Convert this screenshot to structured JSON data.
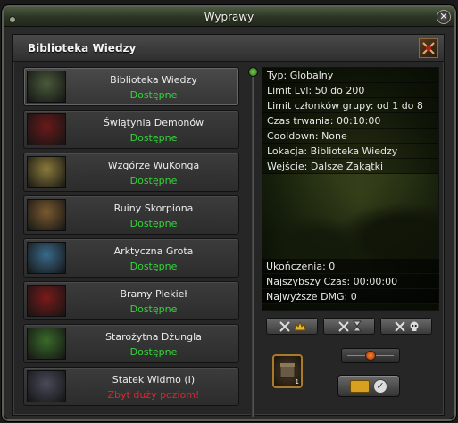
{
  "window": {
    "title": "Wyprawy",
    "close_icon": "close-icon"
  },
  "panel": {
    "title": "Biblioteka Wiedzy",
    "emblem_icon": "crossed-swords-emblem-icon"
  },
  "dungeons": [
    {
      "name": "Biblioteka Wiedzy",
      "status": "Dostępne",
      "available": true,
      "thumb_color": "#4a5a3a"
    },
    {
      "name": "Świątynia Demonów",
      "status": "Dostępne",
      "available": true,
      "thumb_color": "#6a1a1a"
    },
    {
      "name": "Wzgórze WuKonga",
      "status": "Dostępne",
      "available": true,
      "thumb_color": "#8a7a3a"
    },
    {
      "name": "Ruiny Skorpiona",
      "status": "Dostępne",
      "available": true,
      "thumb_color": "#7a5a30"
    },
    {
      "name": "Arktyczna Grota",
      "status": "Dostępne",
      "available": true,
      "thumb_color": "#3a6a8a"
    },
    {
      "name": "Bramy Piekieł",
      "status": "Dostępne",
      "available": true,
      "thumb_color": "#7a1a1a"
    },
    {
      "name": "Starożytna Dżungla",
      "status": "Dostępne",
      "available": true,
      "thumb_color": "#3a6a2a"
    },
    {
      "name": "Statek Widmo (I)",
      "status": "Zbyt duży poziom!",
      "available": false,
      "thumb_color": "#4a4a5a"
    }
  ],
  "details": {
    "lines": [
      "Typ: Globalny",
      "Limit Lvl: 50 do 200",
      "Limit członków grupy: od 1 do 8",
      "Czas trwania: 00:10:00",
      "Cooldown: None",
      "Lokacja: Biblioteka Wiedzy",
      "Wejście: Dalsze Zakątki"
    ],
    "stats": [
      "Ukończenia: 0",
      "Najszybszy Czas: 00:00:00",
      "Najwyższe DMG: 0"
    ]
  },
  "buttons": {
    "sort1_icon": "crown-icon",
    "sort2_icon": "hourglass-icon",
    "sort3_icon": "skull-icon",
    "relic_count": "1",
    "enter_icon": "ticket-check-icon"
  },
  "colors": {
    "available": "#35d33a",
    "unavailable": "#e0262b"
  }
}
